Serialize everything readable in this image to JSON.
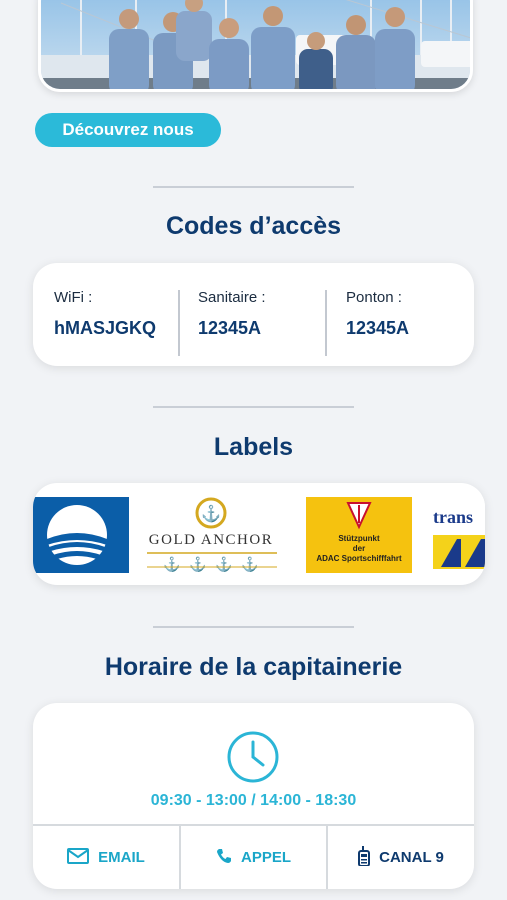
{
  "hero": {
    "cta_label": "Découvrez nous"
  },
  "access_codes": {
    "title": "Codes d’accès",
    "items": [
      {
        "label": "WiFi :",
        "value": "hMASJGKQ"
      },
      {
        "label": "Sanitaire :",
        "value": "12345A"
      },
      {
        "label": "Ponton :",
        "value": "12345A"
      }
    ]
  },
  "labels_section": {
    "title": "Labels",
    "logos": [
      {
        "name": "blue-flag-logo"
      },
      {
        "name": "gold-anchor-logo",
        "text": "GOLD ANCHOR"
      },
      {
        "name": "adac-logo",
        "line1": "Stützpunkt",
        "line2": "der",
        "line3": "ADAC Sportschifffahrt"
      },
      {
        "name": "transeurope-logo",
        "text": "trans"
      }
    ]
  },
  "office_hours": {
    "title": "Horaire de la capitainerie",
    "hours": "09:30 - 13:00 / 14:00 - 18:30",
    "actions": [
      {
        "label": "EMAIL",
        "icon": "mail-icon"
      },
      {
        "label": "APPEL",
        "icon": "phone-icon"
      },
      {
        "label": "CANAL 9",
        "icon": "radio-icon"
      }
    ]
  },
  "colors": {
    "accent": "#2bbad9",
    "primary": "#0e3a6e",
    "background": "#f1f3f6"
  }
}
